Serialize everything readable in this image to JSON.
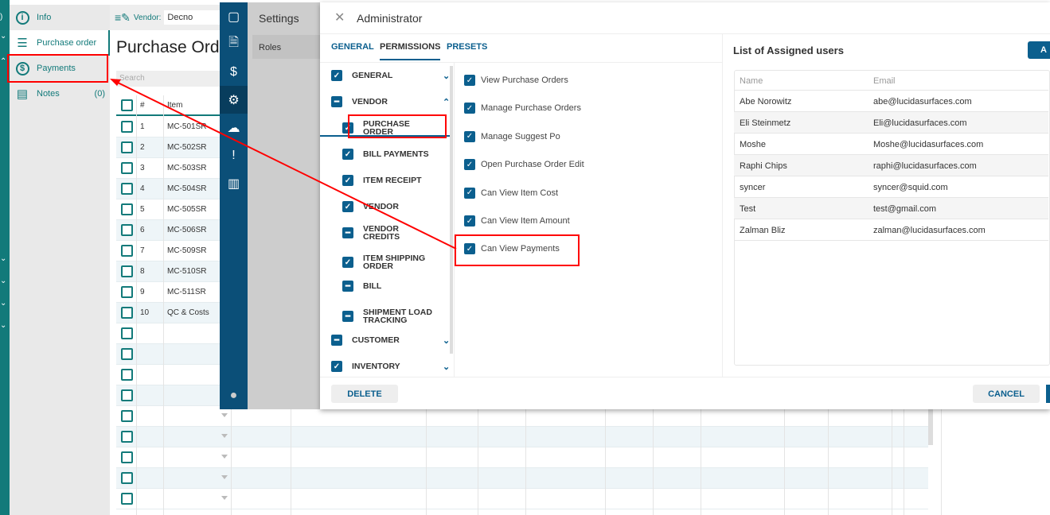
{
  "left_nav": {
    "items": [
      {
        "label": "Info",
        "icon": "info-icon",
        "count": ""
      },
      {
        "label": "Purchase order",
        "icon": "list-icon",
        "count": ""
      },
      {
        "label": "Payments",
        "icon": "dollar-icon",
        "count": ""
      },
      {
        "label": "Notes",
        "icon": "notes-icon",
        "count": "(0)"
      }
    ]
  },
  "toolbar": {
    "vendor_label": "Vendor:",
    "vendor_value": "Decno"
  },
  "page": {
    "title": "Purchase Orde",
    "search_placeholder": "Search"
  },
  "table": {
    "headers": [
      "#",
      "Item"
    ],
    "rows": [
      [
        "1",
        "MC-501SR"
      ],
      [
        "2",
        "MC-502SR"
      ],
      [
        "3",
        "MC-503SR"
      ],
      [
        "4",
        "MC-504SR"
      ],
      [
        "5",
        "MC-505SR"
      ],
      [
        "6",
        "MC-506SR"
      ],
      [
        "7",
        "MC-509SR"
      ],
      [
        "8",
        "MC-510SR"
      ],
      [
        "9",
        "MC-511SR"
      ],
      [
        "10",
        "QC & Costs"
      ]
    ],
    "empty_rows": 9
  },
  "settings": {
    "title": "Settings",
    "menu": [
      "Roles"
    ]
  },
  "dialog": {
    "title": "Administrator",
    "tabs": [
      "GENERAL",
      "PERMISSIONS",
      "PRESETS"
    ],
    "groups": [
      {
        "label": "GENERAL",
        "state": "checked",
        "chevron": "down",
        "level": 0
      },
      {
        "label": "VENDOR",
        "state": "partial",
        "chevron": "up",
        "level": 0
      },
      {
        "label": "PURCHASE ORDER",
        "state": "checked",
        "level": 1,
        "selected": true
      },
      {
        "label": "BILL PAYMENTS",
        "state": "checked",
        "level": 1
      },
      {
        "label": "ITEM RECEIPT",
        "state": "checked",
        "level": 1
      },
      {
        "label": "VENDOR",
        "state": "checked",
        "level": 1
      },
      {
        "label": "VENDOR CREDITS",
        "state": "partial",
        "level": 1
      },
      {
        "label": "ITEM SHIPPING ORDER",
        "state": "checked",
        "level": 1
      },
      {
        "label": "BILL",
        "state": "partial",
        "level": 1
      },
      {
        "label": "SHIPMENT LOAD TRACKING",
        "state": "partial",
        "level": 1
      },
      {
        "label": "CUSTOMER",
        "state": "partial",
        "chevron": "down",
        "level": 0
      },
      {
        "label": "INVENTORY",
        "state": "checked",
        "chevron": "down",
        "level": 0
      }
    ],
    "permissions": [
      "View Purchase Orders",
      "Manage Purchase Orders",
      "Manage Suggest Po",
      "Open Purchase Order Edit",
      "Can View Item Cost",
      "Can View Item Amount",
      "Can View Payments"
    ],
    "users_title": "List of Assigned users",
    "add_button": "A",
    "user_headers": [
      "Name",
      "Email"
    ],
    "users": [
      [
        "Abe Norowitz",
        "abe@lucidasurfaces.com"
      ],
      [
        "Eli Steinmetz",
        "Eli@lucidasurfaces.com"
      ],
      [
        "Moshe",
        "Moshe@lucidasurfaces.com"
      ],
      [
        "Raphi Chips",
        "raphi@lucidasurfaces.com"
      ],
      [
        "syncer",
        "syncer@squid.com"
      ],
      [
        "Test",
        "test@gmail.com"
      ],
      [
        "Zalman Bliz",
        "zalman@lucidasurfaces.com"
      ]
    ],
    "delete_label": "DELETE",
    "cancel_label": "CANCEL"
  },
  "colors": {
    "teal": "#127a7a",
    "navy": "#0b4f78",
    "accent": "#0b5f8e",
    "annotation": "#ff0000"
  }
}
